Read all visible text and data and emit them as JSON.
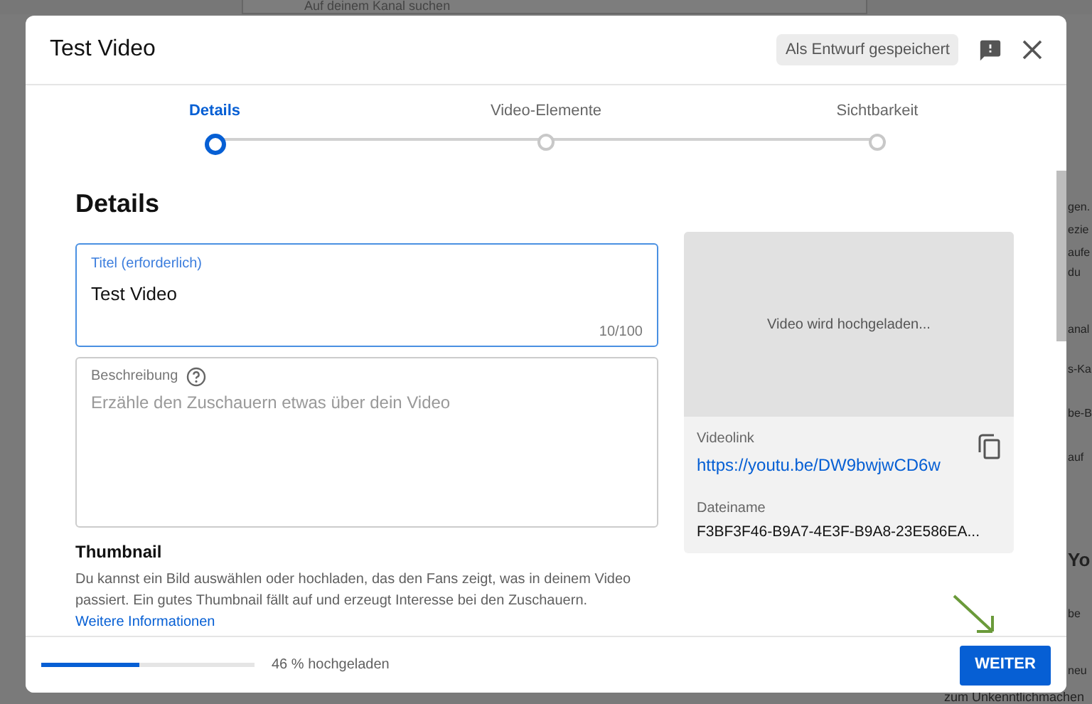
{
  "background_page": {
    "search_placeholder": "Auf deinem Kanal suchen",
    "side_fragments": [
      "gen.",
      "ezie",
      "aufe",
      "du",
      "anal",
      "s-Ka",
      "be-B",
      "auf",
      "Yo",
      "be",
      "neu"
    ],
    "bottom_fragment": "zum Unkenntlichmachen"
  },
  "dialog": {
    "title": "Test Video",
    "save_status": "Als Entwurf gespeichert",
    "steps": [
      {
        "label": "Details",
        "selected": true
      },
      {
        "label": "Video-Elemente",
        "selected": false
      },
      {
        "label": "Sichtbarkeit",
        "selected": false
      }
    ],
    "section_heading": "Details",
    "title_field": {
      "label": "Titel (erforderlich)",
      "value": "Test Video",
      "counter": "10/100",
      "focused": true
    },
    "description_field": {
      "label": "Beschreibung",
      "placeholder": "Erzähle den Zuschauern etwas über dein Video"
    },
    "preview": {
      "status": "Video wird hochgeladen...",
      "link_label": "Videolink",
      "link": "https://youtu.be/DW9bwjwCD6w",
      "filename_label": "Dateiname",
      "filename": "F3BF3F46-B9A7-4E3F-B9A8-23E586EA..."
    },
    "thumbnail": {
      "heading": "Thumbnail",
      "text": "Du kannst ein Bild auswählen oder hochladen, das den Fans zeigt, was in deinem Video passiert. Ein gutes Thumbnail fällt auf und erzeugt Interesse bei den Zuschauern.",
      "link": "Weitere Informationen"
    },
    "footer": {
      "upload": {
        "level": 0.46,
        "reading": "46 % hochgeladen"
      },
      "next_button": "WEITER"
    }
  }
}
